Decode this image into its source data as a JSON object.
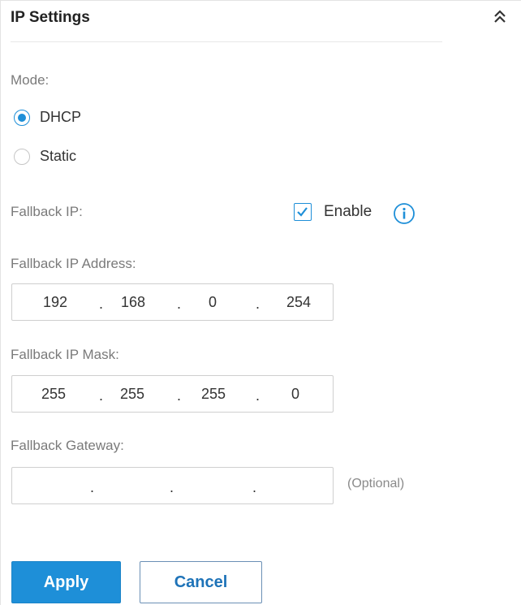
{
  "panel": {
    "title": "IP Settings",
    "collapse_icon": "double-chevron-up-icon"
  },
  "mode": {
    "label": "Mode:",
    "options": [
      {
        "label": "DHCP",
        "checked": true
      },
      {
        "label": "Static",
        "checked": false
      }
    ]
  },
  "fallback_ip": {
    "label": "Fallback IP:",
    "enable_label": "Enable",
    "enabled": true,
    "info_icon": "info-icon"
  },
  "fallback_address": {
    "label": "Fallback IP Address:",
    "octets": [
      "192",
      "168",
      "0",
      "254"
    ]
  },
  "fallback_mask": {
    "label": "Fallback IP Mask:",
    "octets": [
      "255",
      "255",
      "255",
      "0"
    ]
  },
  "fallback_gateway": {
    "label": "Fallback Gateway:",
    "octets": [
      "",
      "",
      "",
      ""
    ],
    "hint": "(Optional)"
  },
  "actions": {
    "apply_label": "Apply",
    "cancel_label": "Cancel"
  },
  "colors": {
    "accent": "#1e8fd8",
    "label_gray": "#7a7a7a"
  }
}
